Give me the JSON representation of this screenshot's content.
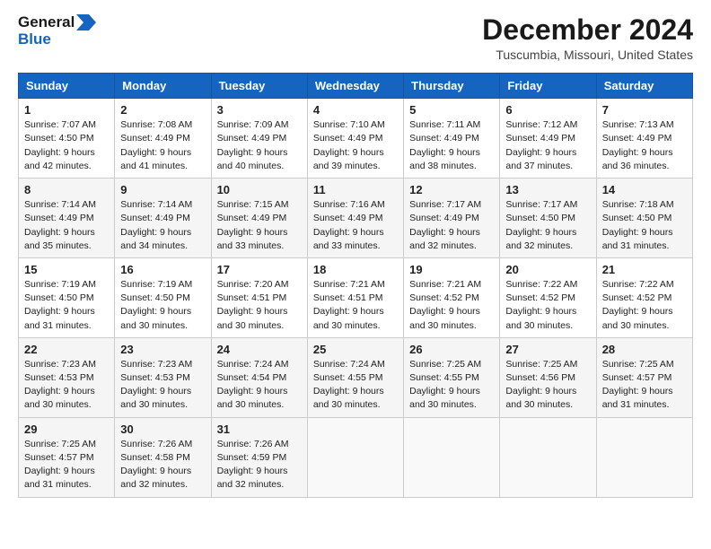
{
  "header": {
    "logo_line1": "General",
    "logo_line2": "Blue",
    "month_title": "December 2024",
    "location": "Tuscumbia, Missouri, United States"
  },
  "days_of_week": [
    "Sunday",
    "Monday",
    "Tuesday",
    "Wednesday",
    "Thursday",
    "Friday",
    "Saturday"
  ],
  "weeks": [
    [
      {
        "day": 1,
        "sunrise": "7:07 AM",
        "sunset": "4:50 PM",
        "daylight": "9 hours and 42 minutes"
      },
      {
        "day": 2,
        "sunrise": "7:08 AM",
        "sunset": "4:49 PM",
        "daylight": "9 hours and 41 minutes"
      },
      {
        "day": 3,
        "sunrise": "7:09 AM",
        "sunset": "4:49 PM",
        "daylight": "9 hours and 40 minutes"
      },
      {
        "day": 4,
        "sunrise": "7:10 AM",
        "sunset": "4:49 PM",
        "daylight": "9 hours and 39 minutes"
      },
      {
        "day": 5,
        "sunrise": "7:11 AM",
        "sunset": "4:49 PM",
        "daylight": "9 hours and 38 minutes"
      },
      {
        "day": 6,
        "sunrise": "7:12 AM",
        "sunset": "4:49 PM",
        "daylight": "9 hours and 37 minutes"
      },
      {
        "day": 7,
        "sunrise": "7:13 AM",
        "sunset": "4:49 PM",
        "daylight": "9 hours and 36 minutes"
      }
    ],
    [
      {
        "day": 8,
        "sunrise": "7:14 AM",
        "sunset": "4:49 PM",
        "daylight": "9 hours and 35 minutes"
      },
      {
        "day": 9,
        "sunrise": "7:14 AM",
        "sunset": "4:49 PM",
        "daylight": "9 hours and 34 minutes"
      },
      {
        "day": 10,
        "sunrise": "7:15 AM",
        "sunset": "4:49 PM",
        "daylight": "9 hours and 33 minutes"
      },
      {
        "day": 11,
        "sunrise": "7:16 AM",
        "sunset": "4:49 PM",
        "daylight": "9 hours and 33 minutes"
      },
      {
        "day": 12,
        "sunrise": "7:17 AM",
        "sunset": "4:49 PM",
        "daylight": "9 hours and 32 minutes"
      },
      {
        "day": 13,
        "sunrise": "7:17 AM",
        "sunset": "4:50 PM",
        "daylight": "9 hours and 32 minutes"
      },
      {
        "day": 14,
        "sunrise": "7:18 AM",
        "sunset": "4:50 PM",
        "daylight": "9 hours and 31 minutes"
      }
    ],
    [
      {
        "day": 15,
        "sunrise": "7:19 AM",
        "sunset": "4:50 PM",
        "daylight": "9 hours and 31 minutes"
      },
      {
        "day": 16,
        "sunrise": "7:19 AM",
        "sunset": "4:50 PM",
        "daylight": "9 hours and 30 minutes"
      },
      {
        "day": 17,
        "sunrise": "7:20 AM",
        "sunset": "4:51 PM",
        "daylight": "9 hours and 30 minutes"
      },
      {
        "day": 18,
        "sunrise": "7:21 AM",
        "sunset": "4:51 PM",
        "daylight": "9 hours and 30 minutes"
      },
      {
        "day": 19,
        "sunrise": "7:21 AM",
        "sunset": "4:52 PM",
        "daylight": "9 hours and 30 minutes"
      },
      {
        "day": 20,
        "sunrise": "7:22 AM",
        "sunset": "4:52 PM",
        "daylight": "9 hours and 30 minutes"
      },
      {
        "day": 21,
        "sunrise": "7:22 AM",
        "sunset": "4:52 PM",
        "daylight": "9 hours and 30 minutes"
      }
    ],
    [
      {
        "day": 22,
        "sunrise": "7:23 AM",
        "sunset": "4:53 PM",
        "daylight": "9 hours and 30 minutes"
      },
      {
        "day": 23,
        "sunrise": "7:23 AM",
        "sunset": "4:53 PM",
        "daylight": "9 hours and 30 minutes"
      },
      {
        "day": 24,
        "sunrise": "7:24 AM",
        "sunset": "4:54 PM",
        "daylight": "9 hours and 30 minutes"
      },
      {
        "day": 25,
        "sunrise": "7:24 AM",
        "sunset": "4:55 PM",
        "daylight": "9 hours and 30 minutes"
      },
      {
        "day": 26,
        "sunrise": "7:25 AM",
        "sunset": "4:55 PM",
        "daylight": "9 hours and 30 minutes"
      },
      {
        "day": 27,
        "sunrise": "7:25 AM",
        "sunset": "4:56 PM",
        "daylight": "9 hours and 30 minutes"
      },
      {
        "day": 28,
        "sunrise": "7:25 AM",
        "sunset": "4:57 PM",
        "daylight": "9 hours and 31 minutes"
      }
    ],
    [
      {
        "day": 29,
        "sunrise": "7:25 AM",
        "sunset": "4:57 PM",
        "daylight": "9 hours and 31 minutes"
      },
      {
        "day": 30,
        "sunrise": "7:26 AM",
        "sunset": "4:58 PM",
        "daylight": "9 hours and 32 minutes"
      },
      {
        "day": 31,
        "sunrise": "7:26 AM",
        "sunset": "4:59 PM",
        "daylight": "9 hours and 32 minutes"
      },
      null,
      null,
      null,
      null
    ]
  ],
  "labels": {
    "sunrise": "Sunrise:",
    "sunset": "Sunset:",
    "daylight": "Daylight:"
  }
}
